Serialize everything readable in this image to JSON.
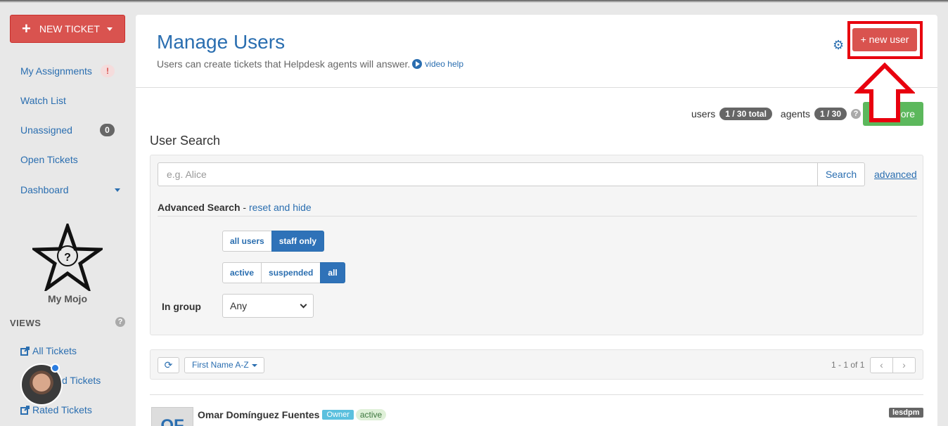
{
  "sidebar": {
    "new_ticket_label": "NEW TICKET",
    "nav": [
      {
        "label": "My Assignments",
        "badge": "!"
      },
      {
        "label": "Watch List"
      },
      {
        "label": "Unassigned",
        "badge": "0"
      },
      {
        "label": "Open Tickets"
      },
      {
        "label": "Dashboard"
      }
    ],
    "mojo_label": "My Mojo",
    "views_label": "VIEWS",
    "views_help": "?",
    "views": [
      {
        "label": "All Tickets"
      },
      {
        "label": "d Tickets"
      },
      {
        "label": "Rated Tickets"
      }
    ]
  },
  "header": {
    "title": "Manage Users",
    "subtitle": "Users can create tickets that Helpdesk agents will answer.",
    "video_help": "video help",
    "new_user_label": "+ new user",
    "settings_icon": "gear-icon"
  },
  "stats": {
    "users_label": "users",
    "users_value": "1 / 30 total",
    "agents_label": "agents",
    "agents_value": "1 / 30",
    "help": "?",
    "buy_more_label": "uy more"
  },
  "search": {
    "section_title": "User Search",
    "placeholder": "e.g. Alice",
    "button_label": "Search",
    "advanced_label": "advanced",
    "advanced_title": "Advanced Search",
    "separator": " - ",
    "reset_label": "reset and hide",
    "role_filter": {
      "options": [
        "all users",
        "staff only"
      ],
      "selected": "staff only"
    },
    "status_filter": {
      "options": [
        "active",
        "suspended",
        "all"
      ],
      "selected": "all"
    },
    "group_label": "In group",
    "group_value": "Any"
  },
  "toolbar": {
    "sort_label": "First Name A-Z",
    "pager_text": "1 - 1 of 1"
  },
  "users": [
    {
      "initials": "OF",
      "name": "Omar Domínguez Fuentes",
      "role_tag": "Owner",
      "status": "active",
      "tag": "lesdpm"
    }
  ],
  "colors": {
    "accent": "#2a6eb0",
    "danger": "#d9534f",
    "success": "#5cb85c",
    "annotation": "#e8000e"
  }
}
